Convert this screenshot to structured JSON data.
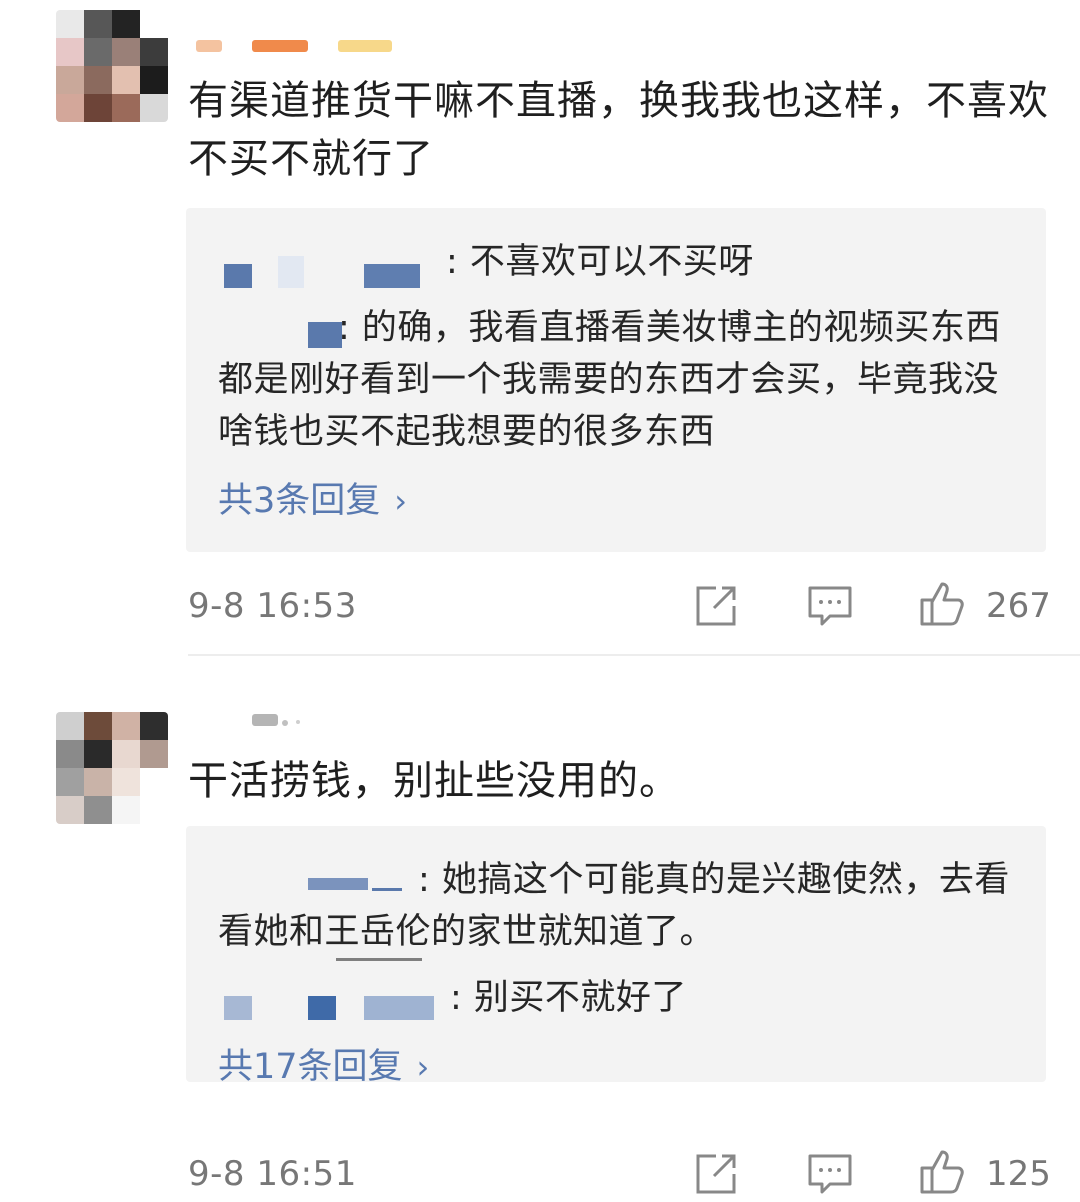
{
  "comments": [
    {
      "text": "有渠道推货干嘛不直播，换我我也这样，不喜欢不买不就行了",
      "replies": [
        {
          "text": ": 不喜欢可以不买呀"
        },
        {
          "text": ": 的确，我看直播看美妆博主的视频买东西都是刚好看到一个我需要的东西才会买，毕竟我没啥钱也买不起我想要的很多东西"
        }
      ],
      "reply_count": "共3条回复",
      "reply_chevron": "›",
      "time": "9-8 16:53",
      "likes": "267"
    },
    {
      "text": "干活捞钱，别扯些没用的。",
      "replies": [
        {
          "text": ": 她搞这个可能真的是兴趣使然，去看看她和王岳伦的家世就知道了。"
        },
        {
          "text": ": 别买不就好了"
        }
      ],
      "reply_count": "共17条回复",
      "reply_chevron": "›",
      "time": "9-8 16:51",
      "likes": "125"
    }
  ],
  "icons": {
    "share": "share-icon",
    "comment": "comment-icon",
    "like": "thumbs-up-icon"
  },
  "colors": {
    "link": "#5879b0",
    "reply_bg": "#f3f3f3",
    "meta_text": "#777777"
  }
}
